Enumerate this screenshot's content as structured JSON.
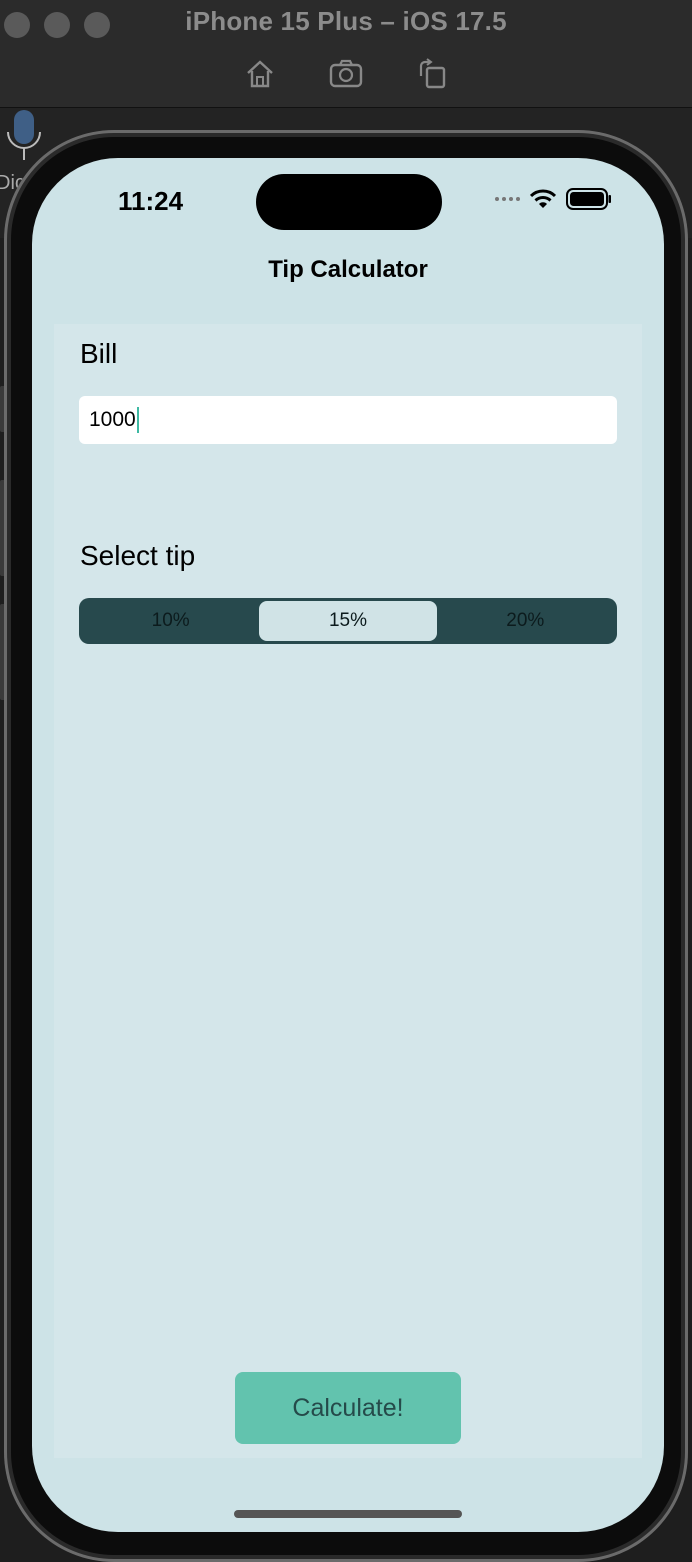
{
  "simulator": {
    "title": "iPhone 15 Plus – iOS 17.5",
    "tools": [
      "home-icon",
      "screenshot-icon",
      "rotate-icon"
    ],
    "side_label": "Dic"
  },
  "status_bar": {
    "time": "11:24"
  },
  "nav": {
    "title": "Tip Calculator"
  },
  "form": {
    "bill_label": "Bill",
    "bill_value": "1000",
    "tip_label": "Select tip",
    "tip_options": [
      "10%",
      "15%",
      "20%"
    ],
    "selected_tip": "15%"
  },
  "actions": {
    "calculate_label": "Calculate!"
  },
  "colors": {
    "screen_bg": "#cde3e7",
    "segment_bg": "#27494d",
    "button_bg": "#62c3ae",
    "caret": "#3fb9a3"
  }
}
